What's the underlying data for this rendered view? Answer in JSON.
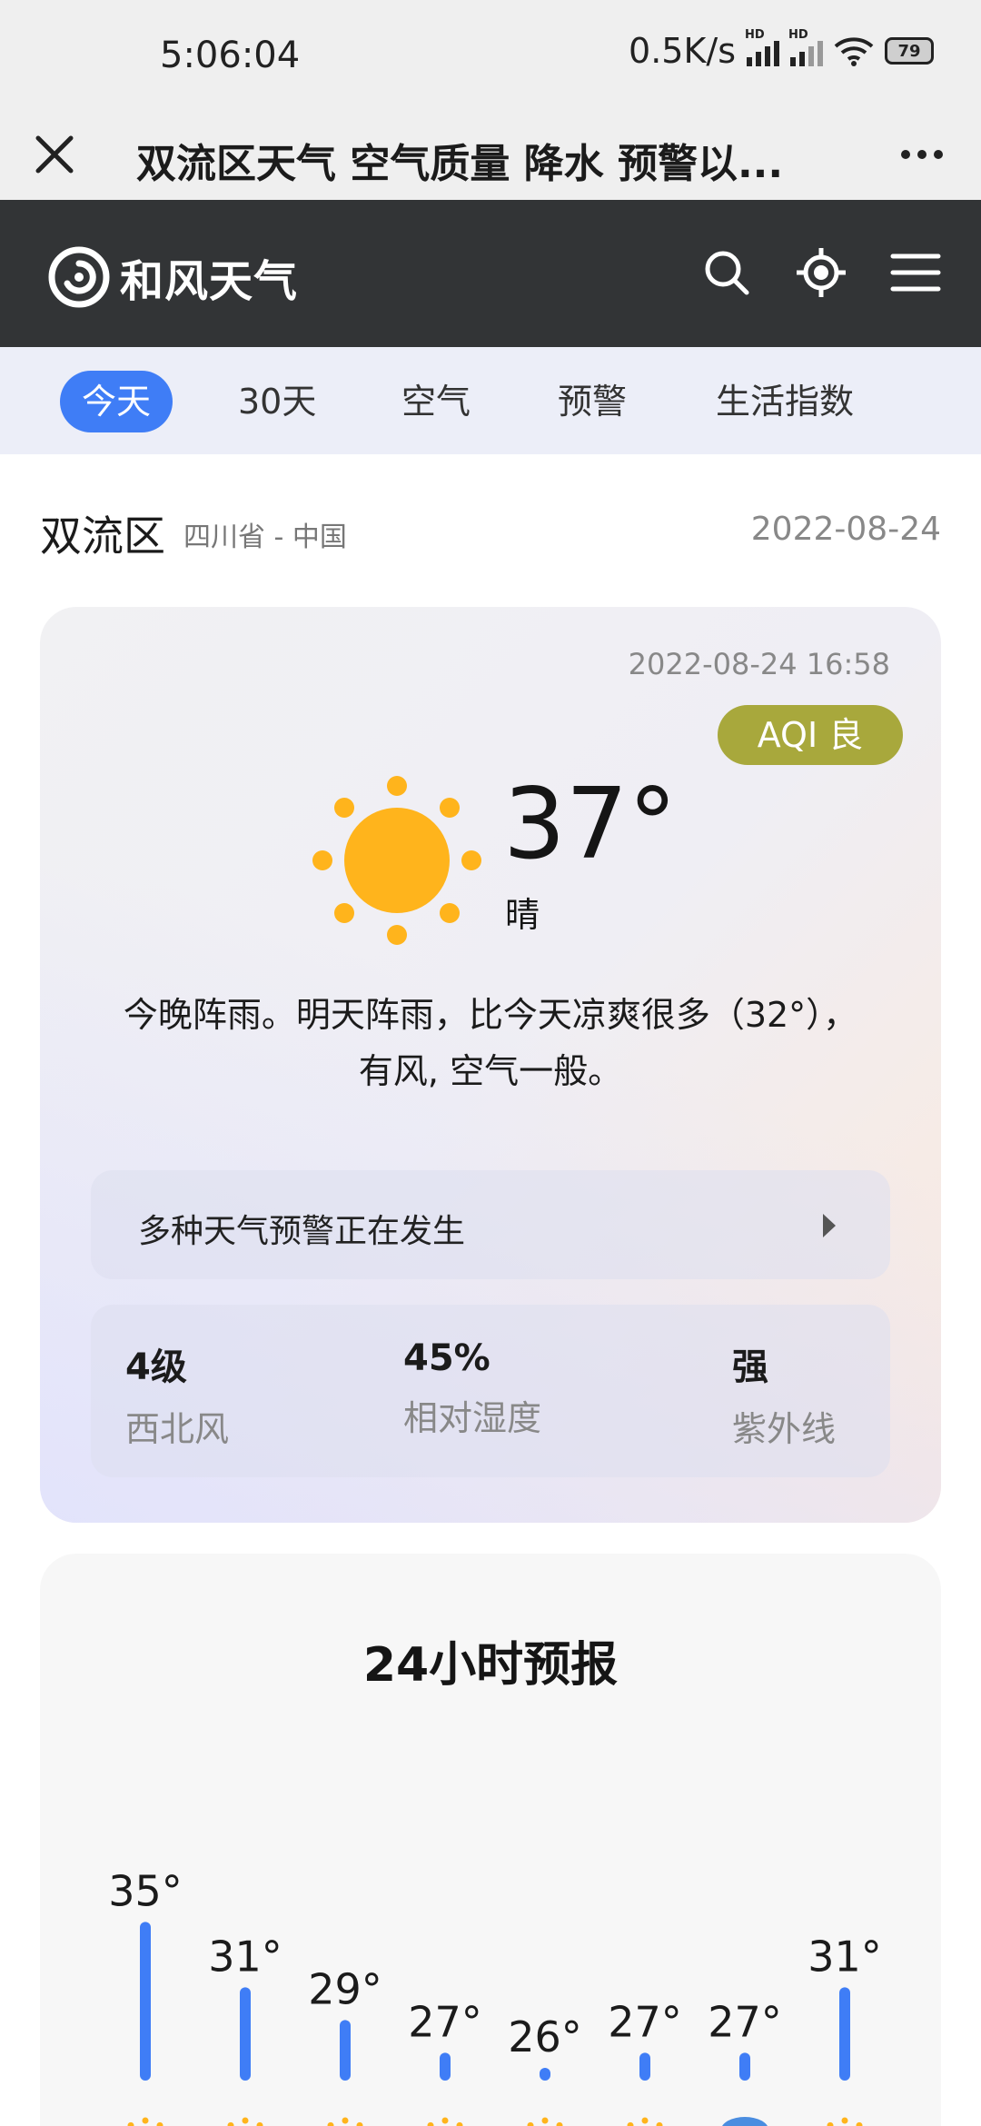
{
  "status_bar": {
    "time": "5:06:04",
    "net_speed": "0.5K/s",
    "signal_label": "HD",
    "battery": "79"
  },
  "browser": {
    "title": "双流区天气 空气质量 降水 预警以..."
  },
  "site": {
    "logo_text": "和风天气"
  },
  "tabs": [
    "今天",
    "30天",
    "空气",
    "预警",
    "生活指数"
  ],
  "location": {
    "name": "双流区",
    "region": "四川省 - 中国",
    "date": "2022-08-24"
  },
  "now": {
    "updated": "2022-08-24 16:58",
    "aqi": "AQI 良",
    "temp": "37°",
    "condition": "晴",
    "summary_line1": "今晚阵雨。明天阵雨，比今天凉爽很多（32°），",
    "summary_line2": "有风, 空气一般。",
    "warning": "多种天气预警正在发生",
    "stats": [
      {
        "value": "4级",
        "label": "西北风"
      },
      {
        "value": "45%",
        "label": "相对湿度"
      },
      {
        "value": "强",
        "label": "紫外线"
      }
    ]
  },
  "forecast_title": "24小时预报",
  "colors": {
    "accent": "#3f7df6",
    "aqi": "#a8a83c",
    "sun": "#ffb41c",
    "header": "#323436"
  },
  "chart_data": {
    "type": "bar",
    "title": "24小时预报",
    "values": [
      35,
      31,
      29,
      27,
      26,
      27,
      27,
      31
    ],
    "value_labels": [
      "35°",
      "31°",
      "29°",
      "27°",
      "26°",
      "27°",
      "27°",
      "31°"
    ],
    "icons": [
      "sun-icon",
      "sun-icon",
      "sun-icon",
      "sun-icon",
      "sun-icon",
      "sun-icon",
      "cloud-icon",
      "sun-icon"
    ]
  }
}
